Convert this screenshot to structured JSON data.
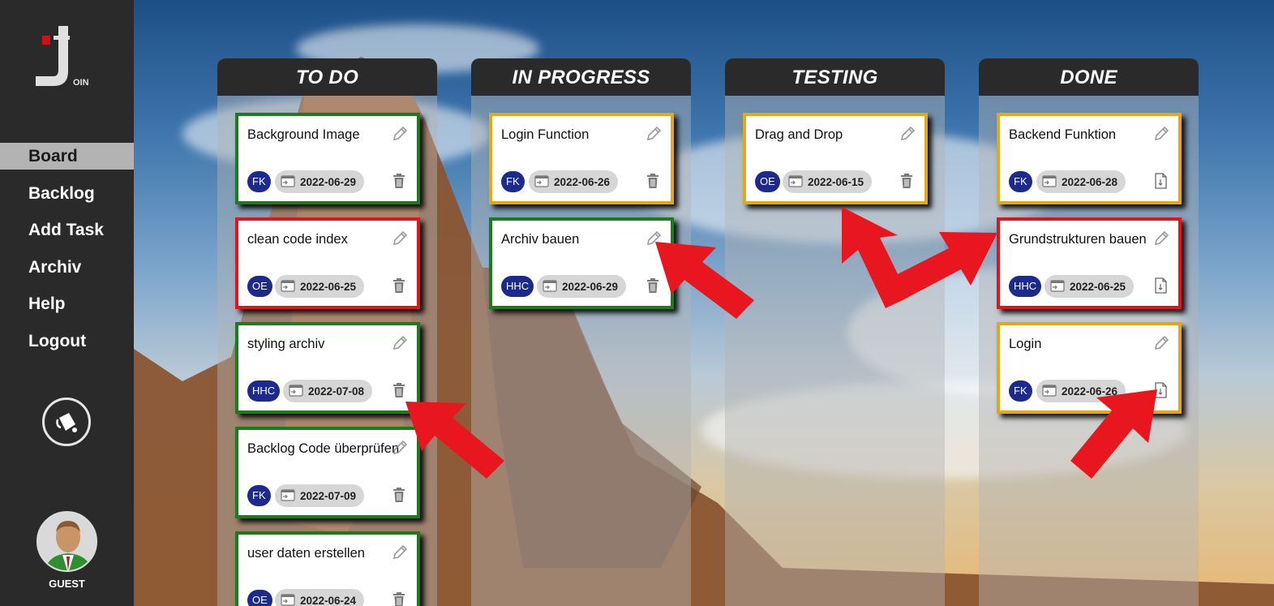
{
  "app": {
    "logo_icon": "join-logo-icon"
  },
  "sidebar": {
    "items": [
      {
        "label": "Board",
        "active": true
      },
      {
        "label": "Backlog",
        "active": false
      },
      {
        "label": "Add Task",
        "active": false
      },
      {
        "label": "Archiv",
        "active": false
      },
      {
        "label": "Help",
        "active": false
      },
      {
        "label": "Logout",
        "active": false
      }
    ],
    "theme_icon": "paint-bucket-icon",
    "user_label": "GUEST"
  },
  "colors": {
    "urgent": "#e0141c",
    "medium": "#e3a718",
    "low": "#1e7a1e",
    "badge": "#1b2a8c",
    "sidebar": "#2a2a2a"
  },
  "columns": [
    {
      "title": "TO DO",
      "cards": [
        {
          "title": "Background Image",
          "user": "FK",
          "date": "2022-06-29",
          "priority": "green",
          "action": "trash"
        },
        {
          "title": "clean code index",
          "user": "OE",
          "date": "2022-06-25",
          "priority": "red",
          "action": "trash"
        },
        {
          "title": "styling archiv",
          "user": "HHC",
          "date": "2022-07-08",
          "priority": "green",
          "action": "trash"
        },
        {
          "title": "Backlog Code überprüfen",
          "user": "FK",
          "date": "2022-07-09",
          "priority": "green",
          "action": "trash"
        },
        {
          "title": "user daten erstellen",
          "user": "OE",
          "date": "2022-06-24",
          "priority": "green",
          "action": "trash"
        }
      ]
    },
    {
      "title": "IN PROGRESS",
      "cards": [
        {
          "title": "Login Function",
          "user": "FK",
          "date": "2022-06-26",
          "priority": "yellow",
          "action": "trash"
        },
        {
          "title": "Archiv bauen",
          "user": "HHC",
          "date": "2022-06-29",
          "priority": "green",
          "action": "trash"
        }
      ]
    },
    {
      "title": "TESTING",
      "cards": [
        {
          "title": "Drag and Drop",
          "user": "OE",
          "date": "2022-06-15",
          "priority": "yellow",
          "action": "trash"
        }
      ]
    },
    {
      "title": "DONE",
      "cards": [
        {
          "title": "Backend Funktion",
          "user": "FK",
          "date": "2022-06-28",
          "priority": "yellow",
          "action": "archive"
        },
        {
          "title": "Grundstrukturen bauen",
          "user": "HHC",
          "date": "2022-06-25",
          "priority": "red",
          "action": "archive"
        },
        {
          "title": "Login",
          "user": "FK",
          "date": "2022-06-26",
          "priority": "yellow",
          "action": "archive"
        }
      ]
    }
  ]
}
